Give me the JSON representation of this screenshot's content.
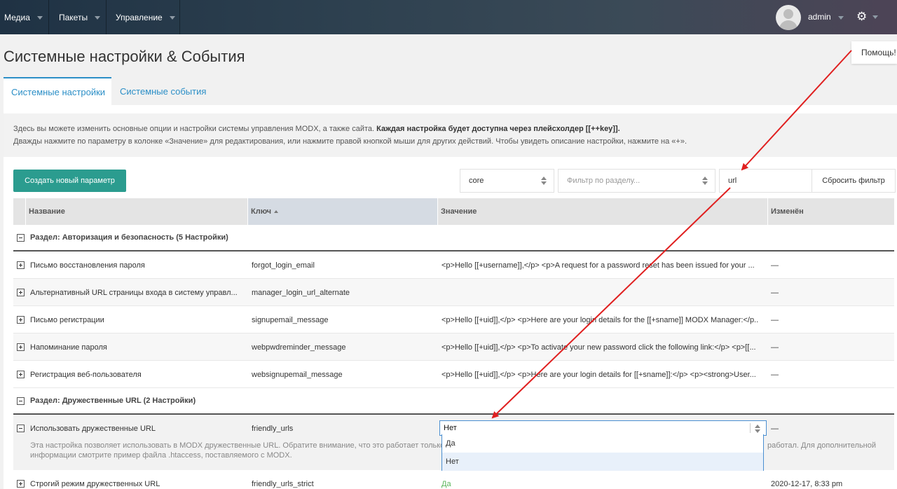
{
  "topbar": {
    "nav": [
      {
        "label": "Медиа"
      },
      {
        "label": "Пакеты"
      },
      {
        "label": "Управление"
      }
    ],
    "user": "admin",
    "help": "Помощь!"
  },
  "page": {
    "title": "Системные настройки & События",
    "tabs": [
      {
        "label": "Системные настройки",
        "active": true
      },
      {
        "label": "Системные события",
        "active": false
      }
    ],
    "description_line1": "Здесь вы можете изменить основные опции и настройки системы управления MODX, а также сайта.",
    "description_line1_bold": "Каждая настройка будет доступна через плейсхолдер [[++key]].",
    "description_line2": "Дважды нажмите по параметру в колонке «Значение» для редактирования, или нажмите правой кнопкой мыши для других действий. Чтобы увидеть описание настройки, нажмите на «+»."
  },
  "toolbar": {
    "create_label": "Создать новый параметр",
    "namespace_value": "core",
    "area_placeholder": "Фильтр по разделу...",
    "search_value": "url",
    "reset_label": "Сбросить фильтр"
  },
  "grid": {
    "columns": [
      "Название",
      "Ключ",
      "Значение",
      "Изменён"
    ],
    "groups": [
      {
        "title": "Раздел: Авторизация и безопасность (5 Настройки)",
        "rows": [
          {
            "name": "Письмо восстановления пароля",
            "key": "forgot_login_email",
            "value": "<p>Hello [[+username]],</p> <p>A request for a password reset has been issued for your ...",
            "changed": "—"
          },
          {
            "name": "Альтернативный URL страницы входа в систему управл...",
            "key": "manager_login_url_alternate",
            "value": "",
            "changed": "—"
          },
          {
            "name": "Письмо регистрации",
            "key": "signupemail_message",
            "value": "<p>Hello [[+uid]],</p> <p>Here are your login details for the [[+sname]] MODX Manager:</p...",
            "changed": "—"
          },
          {
            "name": "Напоминание пароля",
            "key": "webpwdreminder_message",
            "value": "<p>Hello [[+uid]],</p> <p>To activate your new password click the following link:</p> <p>[[...",
            "changed": "—"
          },
          {
            "name": "Регистрация веб-пользователя",
            "key": "websignupemail_message",
            "value": "<p>Hello [[+uid]],</p> <p>Here are your login details for [[+sname]]:</p> <p><strong>User...",
            "changed": "—"
          }
        ]
      },
      {
        "title": "Раздел: Дружественные URL (2 Настройки)",
        "rows": [
          {
            "name": "Использовать дружественные URL",
            "key": "friendly_urls",
            "value": "Нет",
            "changed": "—",
            "desc_line1_left": "Эта настройка позволяет использовать в MODX дружественные URL. Обратите внимание, что это работает только",
            "desc_line1_right": "работал. Для дополнительной",
            "desc_line2": "информации смотрите пример файла .htaccess, поставляемого с MODX."
          },
          {
            "name": "Строгий режим дружественных URL",
            "key": "friendly_urls_strict",
            "value": "Да",
            "changed": "2020-12-17, 8:33 pm"
          }
        ]
      }
    ]
  },
  "editor": {
    "value": "Нет",
    "options": [
      "Да",
      "Нет"
    ]
  },
  "colors": {
    "accent": "#2c8fc7",
    "create_button": "#2b9c8f",
    "annotation_arrow": "#e02020",
    "true_value": "#5bb55b"
  }
}
